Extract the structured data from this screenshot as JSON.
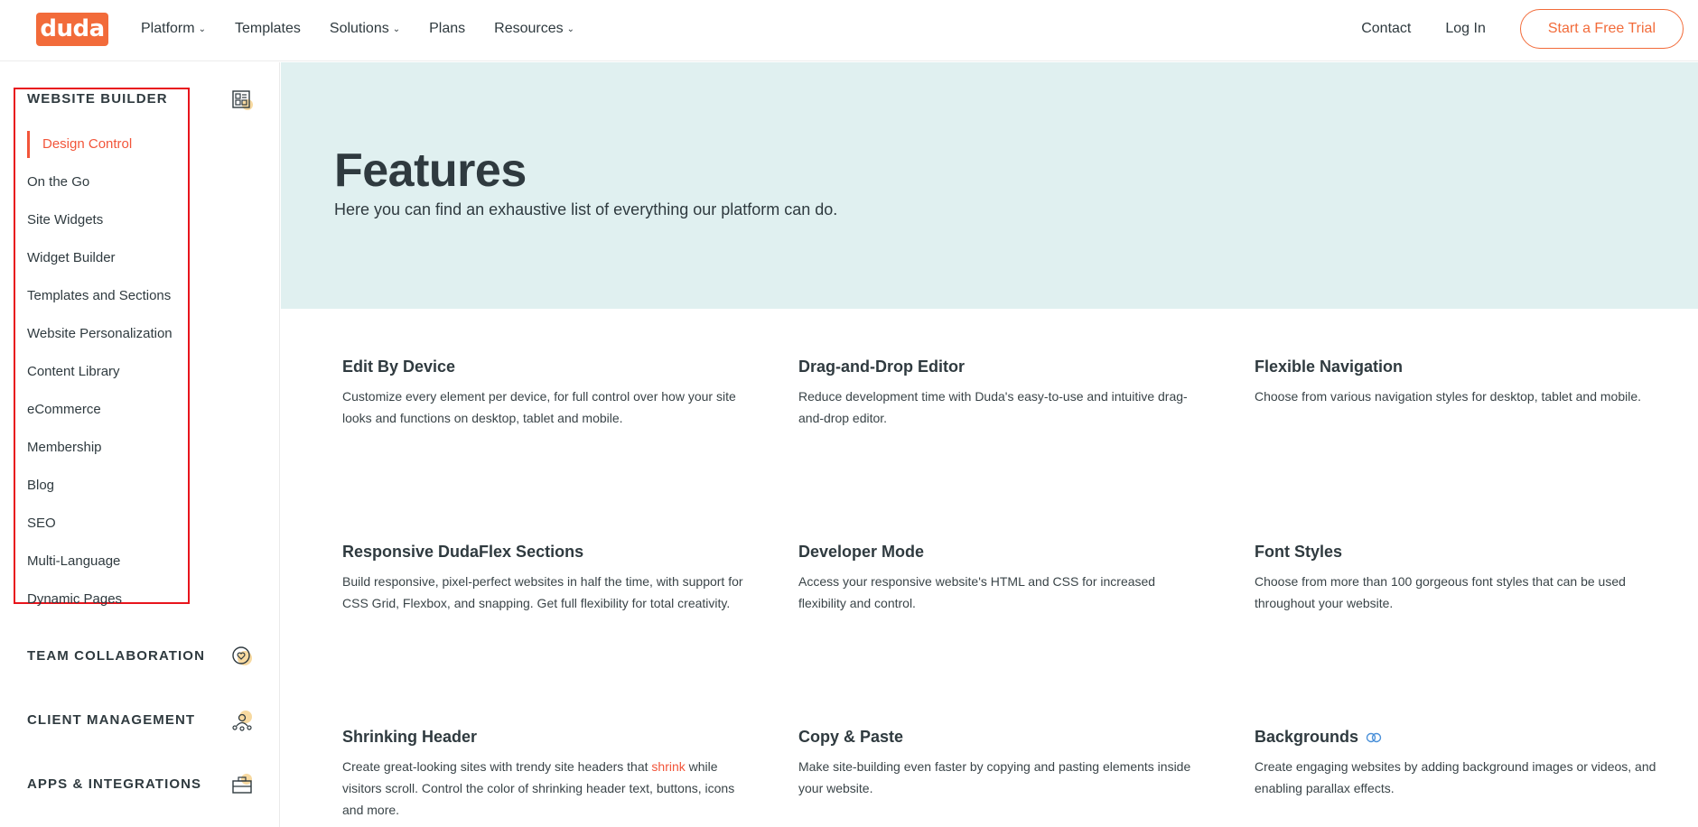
{
  "header": {
    "logo_text": "duda",
    "nav": [
      {
        "label": "Platform",
        "has_caret": true
      },
      {
        "label": "Templates",
        "has_caret": false
      },
      {
        "label": "Solutions",
        "has_caret": true
      },
      {
        "label": "Plans",
        "has_caret": false
      },
      {
        "label": "Resources",
        "has_caret": true
      }
    ],
    "caret_icon": "chevron-down-icon",
    "contact_label": "Contact",
    "login_label": "Log In",
    "trial_label": "Start a Free Trial"
  },
  "sidebar": {
    "website_builder": {
      "title": "WEBSITE BUILDER",
      "icon": "layout-grid-icon",
      "items": [
        {
          "label": "Design Control",
          "active": true
        },
        {
          "label": "On the Go"
        },
        {
          "label": "Site Widgets"
        },
        {
          "label": "Widget Builder"
        },
        {
          "label": "Templates and Sections"
        },
        {
          "label": "Website Personalization"
        },
        {
          "label": "Content Library"
        },
        {
          "label": "eCommerce"
        },
        {
          "label": "Membership"
        },
        {
          "label": "Blog"
        },
        {
          "label": "SEO"
        },
        {
          "label": "Multi-Language"
        },
        {
          "label": "Dynamic Pages"
        }
      ]
    },
    "team_collaboration": {
      "title": "TEAM COLLABORATION",
      "icon": "chat-heart-icon"
    },
    "client_management": {
      "title": "CLIENT MANAGEMENT",
      "icon": "user-group-icon"
    },
    "apps_integrations": {
      "title": "APPS & INTEGRATIONS",
      "icon": "toolbox-icon"
    }
  },
  "hero": {
    "title": "Features",
    "subtitle": "Here you can find an exhaustive list of everything our platform can do."
  },
  "features": [
    {
      "title": "Edit By Device",
      "text": "Customize every element per device, for full control over how your site looks and functions on desktop, tablet and mobile."
    },
    {
      "title": "Drag-and-Drop Editor",
      "text": "Reduce development time with Duda's easy-to-use and intuitive drag-and-drop editor."
    },
    {
      "title": "Flexible Navigation",
      "text": "Choose from various navigation styles for desktop, tablet and mobile."
    },
    {
      "title": "Responsive DudaFlex Sections",
      "text": "Build responsive, pixel-perfect websites in half the time, with support for CSS Grid, Flexbox, and snapping. Get full flexibility for total creativity."
    },
    {
      "title": "Developer Mode",
      "text": "Access your responsive website's HTML and CSS for increased flexibility and control."
    },
    {
      "title": "Font Styles",
      "text": "Choose from more than 100 gorgeous font styles that can be used throughout your website."
    },
    {
      "title": "Shrinking Header",
      "text_before": "Create great-looking sites with trendy site headers that ",
      "text_highlight": "shrink",
      "text_after": " while visitors scroll. Control the color of shrinking header text, buttons, icons and more."
    },
    {
      "title": "Copy & Paste",
      "text": "Make site-building even faster by copying and pasting elements inside your website."
    },
    {
      "title": "Backgrounds",
      "text": "Create engaging websites by adding background images or videos, and enabling parallax effects.",
      "badge_icon": "link-rings-icon"
    }
  ],
  "colors": {
    "brand_orange": "#f26b3a",
    "hero_bg": "#e0f0f0",
    "highlight_box": "#e8141c",
    "badge_blue": "#4a90d9"
  }
}
